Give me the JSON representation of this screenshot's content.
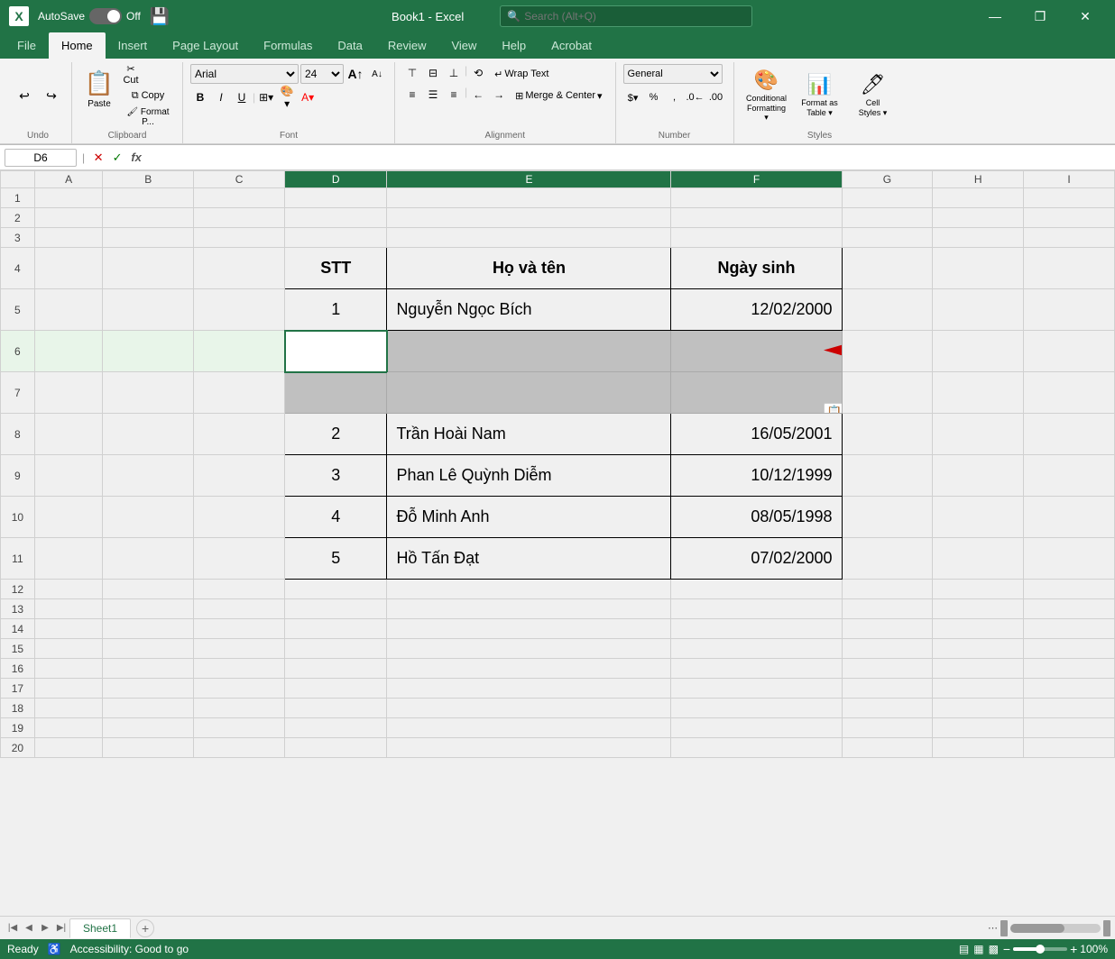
{
  "titleBar": {
    "logo": "X",
    "autosave_label": "AutoSave",
    "toggle_state": "Off",
    "save_icon": "💾",
    "filename": "Book1  -  Excel",
    "search_placeholder": "Search (Alt+Q)",
    "min_label": "—",
    "restore_label": "❐",
    "close_label": "✕"
  },
  "ribbon": {
    "tabs": [
      "File",
      "Home",
      "Insert",
      "Page Layout",
      "Formulas",
      "Data",
      "Review",
      "View",
      "Help",
      "Acrobat"
    ],
    "active_tab": "Home",
    "groups": {
      "undo": {
        "label": "Undo",
        "undo_btn": "↩",
        "redo_btn": "↪"
      },
      "clipboard": {
        "label": "Clipboard",
        "paste_label": "Paste",
        "cut_label": "✂",
        "copy_label": "⧉",
        "format_painter": "🖌"
      },
      "font": {
        "label": "Font",
        "font_name": "Arial",
        "font_size": "24",
        "grow_icon": "A",
        "shrink_icon": "A",
        "bold": "B",
        "italic": "I",
        "underline": "U",
        "border_icon": "⊞",
        "fill_icon": "A",
        "font_color": "A"
      },
      "alignment": {
        "label": "Alignment",
        "wrap_text": "Wrap Text",
        "merge_center": "Merge & Center",
        "align_top": "⊤",
        "align_middle": "≡",
        "align_bottom": "⊥",
        "align_left": "≡",
        "align_center": "≡",
        "align_right": "≡",
        "decrease_indent": "←",
        "increase_indent": "→",
        "orientation": "⟲"
      },
      "number": {
        "label": "Number",
        "format": "General",
        "dollar": "$",
        "percent": "%",
        "comma": ",",
        "decrease_decimal": ".0",
        "increase_decimal": ".00"
      },
      "styles": {
        "label": "Styles",
        "conditional_formatting": "Conditional Formatting",
        "format_as_table": "Format as Table",
        "cell_styles": "Cell Styles"
      }
    }
  },
  "formulaBar": {
    "cell_ref": "D6",
    "cancel_icon": "✕",
    "confirm_icon": "✓",
    "function_icon": "fx",
    "formula_value": ""
  },
  "columns": {
    "headers": [
      "",
      "A",
      "B",
      "C",
      "D",
      "E",
      "F",
      "G",
      "H",
      "I"
    ],
    "widths": [
      30,
      60,
      80,
      80,
      80,
      240,
      160,
      80,
      80,
      80
    ]
  },
  "rows": {
    "count": 20,
    "headers": [
      "1",
      "2",
      "3",
      "4",
      "5",
      "6",
      "7",
      "8",
      "9",
      "10",
      "11",
      "12",
      "13",
      "14",
      "15",
      "16",
      "17",
      "18",
      "19",
      "20"
    ]
  },
  "tableData": {
    "startRow": 4,
    "startCol": 3,
    "headers": [
      "STT",
      "Họ và tên",
      "Ngày sinh"
    ],
    "data": [
      [
        "1",
        "Nguyễn Ngọc Bích",
        "12/02/2000"
      ],
      [
        "",
        "",
        ""
      ],
      [
        "",
        "",
        ""
      ],
      [
        "2",
        "Trần Hoài Nam",
        "16/05/2001"
      ],
      [
        "3",
        "Phan Lê Quỳnh Diễm",
        "10/12/1999"
      ],
      [
        "4",
        "Đỗ Minh Anh",
        "08/05/1998"
      ],
      [
        "5",
        "Hồ Tấn Đạt",
        "07/02/2000"
      ]
    ]
  },
  "sheetTabs": {
    "tabs": [
      "Sheet1"
    ],
    "active": "Sheet1"
  },
  "statusBar": {
    "ready": "Ready",
    "accessibility": "Accessibility: Good to go"
  },
  "selectedCell": "D6"
}
